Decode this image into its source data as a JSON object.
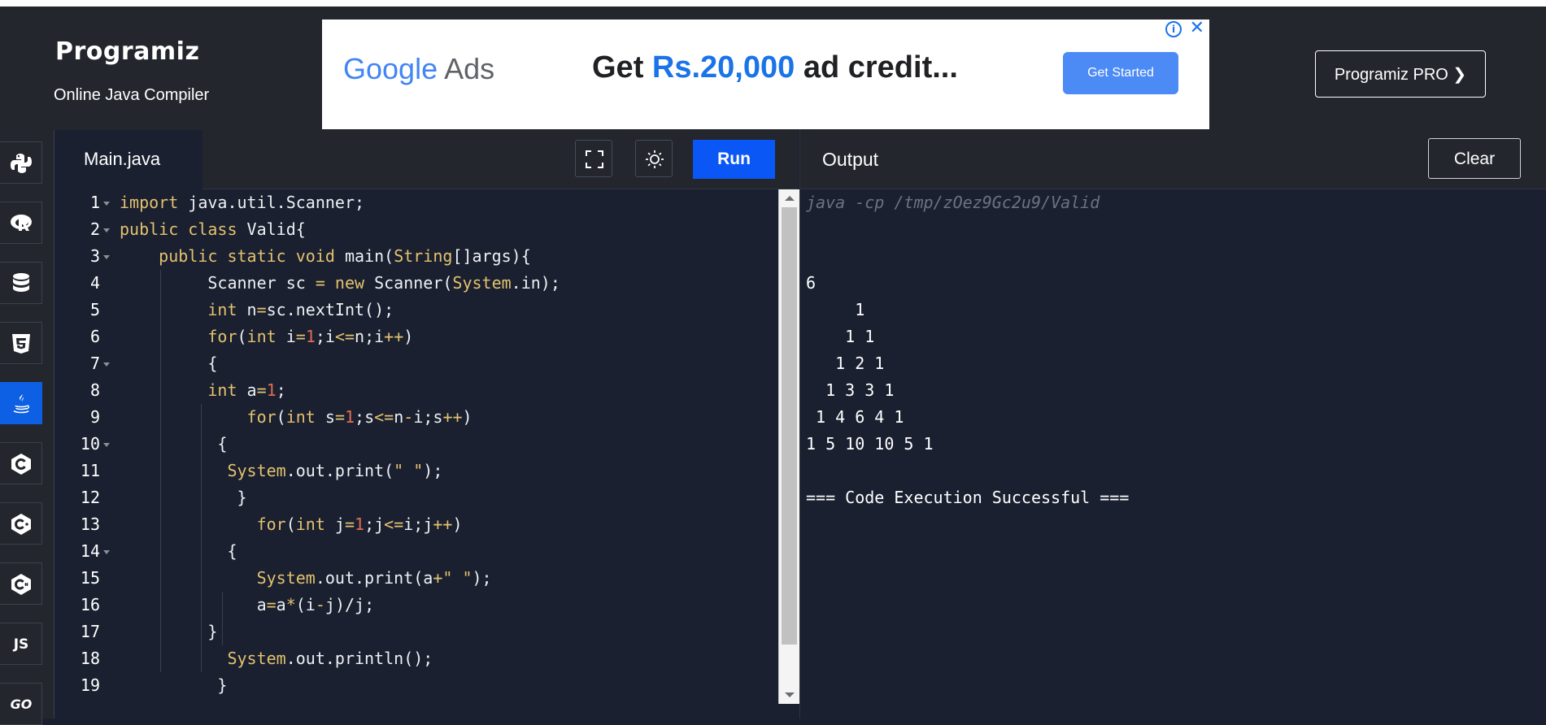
{
  "header": {
    "logo_text": "Programiz",
    "subtitle": "Online Java Compiler",
    "pro_button": "Programiz PRO ❯"
  },
  "ad": {
    "brand_google": "Google",
    "brand_ads": "Ads",
    "headline_prefix": "Get ",
    "headline_amount": "Rs.20,000",
    "headline_suffix": " ad credit...",
    "cta": "Get Started",
    "info": "i",
    "close": "✕"
  },
  "sidebar": {
    "items": [
      {
        "name": "python",
        "icon": "python-icon"
      },
      {
        "name": "r",
        "icon": "r-icon"
      },
      {
        "name": "sql",
        "icon": "database-icon"
      },
      {
        "name": "html",
        "icon": "html5-icon"
      },
      {
        "name": "java",
        "icon": "java-icon",
        "active": true
      },
      {
        "name": "c",
        "icon": "c-icon"
      },
      {
        "name": "cpp",
        "icon": "cpp-icon"
      },
      {
        "name": "csharp",
        "icon": "csharp-icon"
      },
      {
        "name": "js",
        "icon": "js-icon",
        "label": "JS"
      },
      {
        "name": "go",
        "icon": "go-icon",
        "label": "GO"
      }
    ]
  },
  "editor": {
    "tab": "Main.java",
    "run_label": "Run",
    "fullscreen_icon": "fullscreen-icon",
    "theme_icon": "sun-icon",
    "line_numbers": [
      "1",
      "2",
      "3",
      "4",
      "5",
      "6",
      "7",
      "8",
      "9",
      "10",
      "11",
      "12",
      "13",
      "14",
      "15",
      "16",
      "17",
      "18",
      "19"
    ]
  },
  "output": {
    "title": "Output",
    "clear_label": "Clear",
    "command": "java -cp /tmp/zOez9Gc2u9/Valid",
    "lines": [
      "6",
      "     1",
      "    1 1",
      "   1 2 1",
      "  1 3 3 1",
      " 1 4 6 4 1",
      "1 5 10 10 5 1",
      "",
      "=== Code Execution Successful ==="
    ]
  }
}
